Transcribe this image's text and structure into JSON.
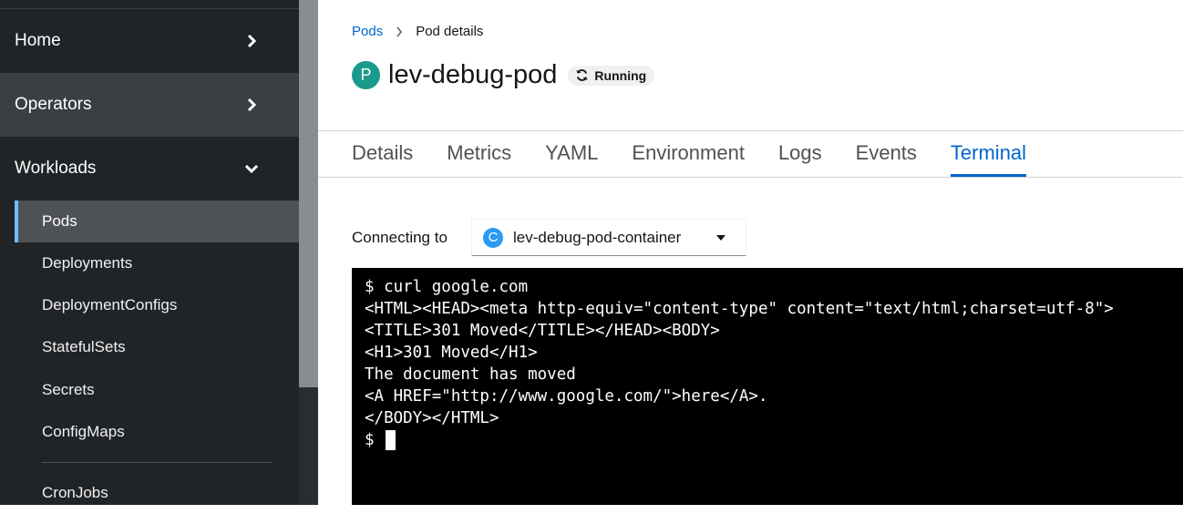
{
  "sidebar": {
    "sections": [
      {
        "label": "Home",
        "icon": "chevron-right-icon"
      },
      {
        "label": "Operators",
        "icon": "chevron-right-icon"
      },
      {
        "label": "Workloads",
        "icon": "chevron-down-icon"
      }
    ],
    "workload_items": [
      {
        "label": "Pods",
        "active": true
      },
      {
        "label": "Deployments"
      },
      {
        "label": "DeploymentConfigs"
      },
      {
        "label": "StatefulSets"
      },
      {
        "label": "Secrets"
      },
      {
        "label": "ConfigMaps"
      },
      {
        "label": "CronJobs"
      }
    ]
  },
  "breadcrumb": {
    "parent": "Pods",
    "current": "Pod details"
  },
  "header": {
    "badge": "P",
    "title": "lev-debug-pod",
    "status": "Running",
    "status_icon": "sync-icon"
  },
  "tabs": [
    "Details",
    "Metrics",
    "YAML",
    "Environment",
    "Logs",
    "Events",
    "Terminal"
  ],
  "active_tab": "Terminal",
  "terminal": {
    "connect_label": "Connecting to",
    "container_badge": "C",
    "container_name": "lev-debug-pod-container",
    "lines": [
      "$ curl google.com",
      "<HTML><HEAD><meta http-equiv=\"content-type\" content=\"text/html;charset=utf-8\">",
      "<TITLE>301 Moved</TITLE></HEAD><BODY>",
      "<H1>301 Moved</H1>",
      "The document has moved",
      "<A HREF=\"http://www.google.com/\">here</A>.",
      "</BODY></HTML>"
    ],
    "prompt": "$"
  },
  "colors": {
    "sidebar_bg": "#212427",
    "accent": "#0066cc",
    "pod_badge": "#1a9a8c",
    "container_badge": "#2b9af3"
  }
}
